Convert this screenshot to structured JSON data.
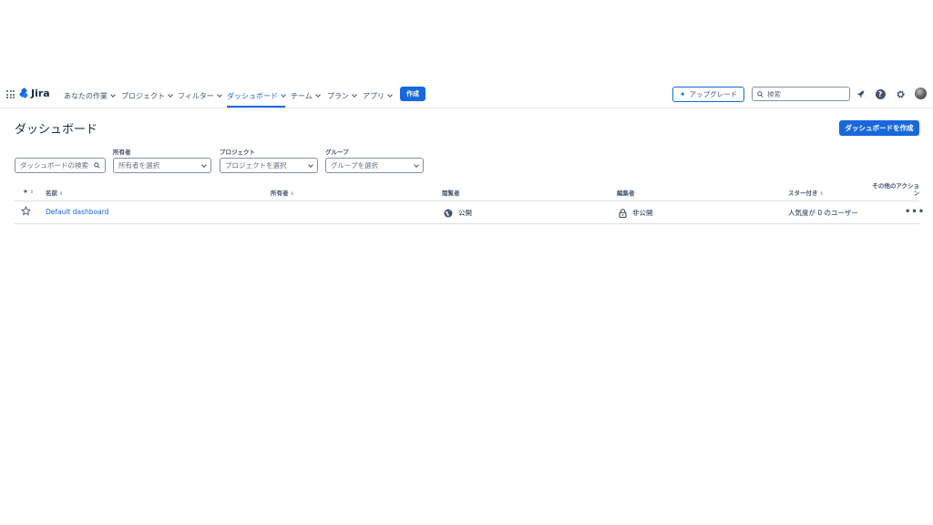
{
  "app": {
    "name": "Jira"
  },
  "nav": {
    "items": [
      {
        "label": "あなたの作業"
      },
      {
        "label": "プロジェクト"
      },
      {
        "label": "フィルター"
      },
      {
        "label": "ダッシュボード",
        "active": true
      },
      {
        "label": "チーム"
      },
      {
        "label": "プラン"
      },
      {
        "label": "アプリ"
      }
    ],
    "create_label": "作成",
    "upgrade_label": "アップグレード",
    "search_placeholder": "検索"
  },
  "page": {
    "title": "ダッシュボード",
    "create_dashboard_label": "ダッシュボードを作成"
  },
  "filters": {
    "search_placeholder": "ダッシュボードの検索",
    "owner": {
      "label": "所有者",
      "placeholder": "所有者を選択"
    },
    "project": {
      "label": "プロジェクト",
      "placeholder": "プロジェクトを選択"
    },
    "group": {
      "label": "グループ",
      "placeholder": "グループを選択"
    }
  },
  "table": {
    "headers": {
      "star": "★",
      "name": "名前",
      "owner": "所有者",
      "viewers": "閲覧者",
      "editors": "編集者",
      "starred_by": "スター付き",
      "more_actions": "その他のアクション"
    },
    "rows": [
      {
        "name": "Default dashboard",
        "owner": "",
        "viewers": "公開",
        "editors": "非公開",
        "starred_by": "人気度が 0 のユーザー"
      }
    ]
  },
  "colors": {
    "accent": "#1868db",
    "text": "#172b4d",
    "subtle": "#44546f"
  }
}
